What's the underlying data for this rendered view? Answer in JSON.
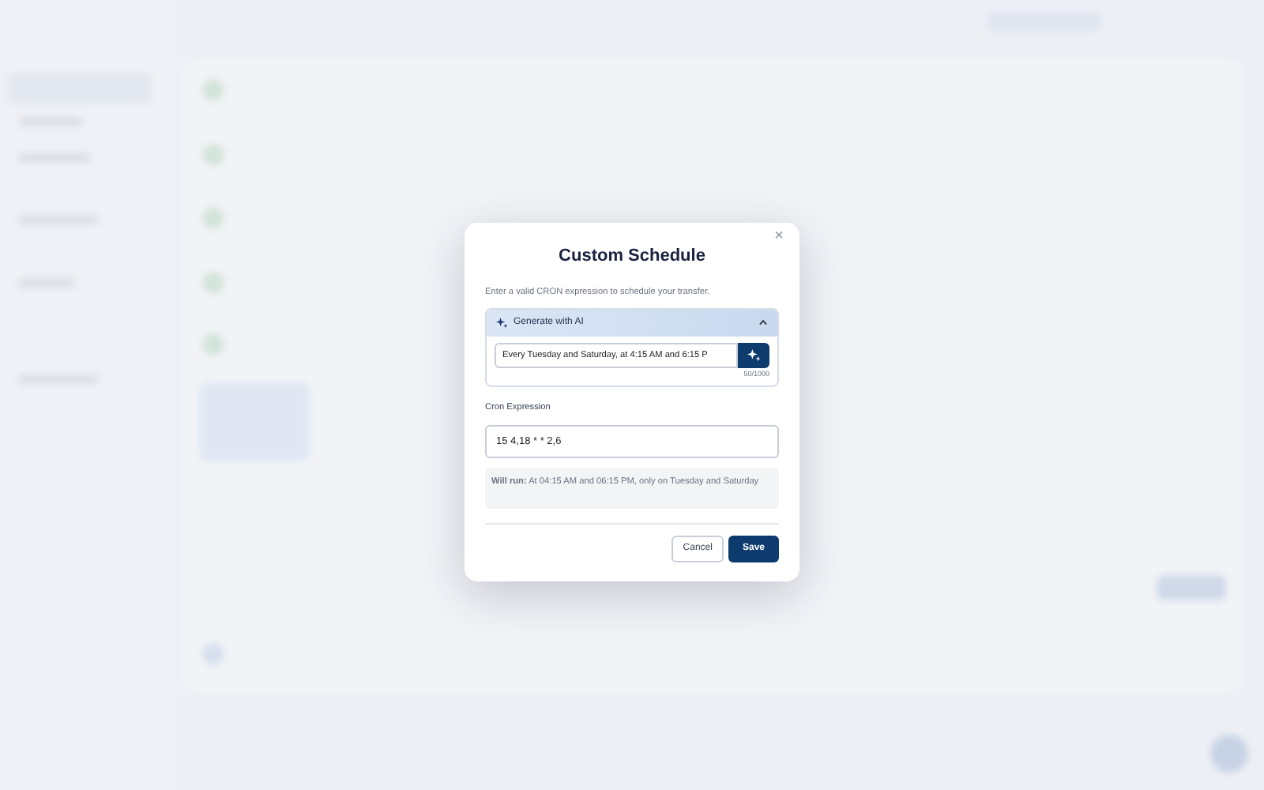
{
  "dialog": {
    "title": "Custom Schedule",
    "close": "×",
    "description": "Enter a valid CRON expression to schedule your transfer.",
    "ai_panel": {
      "title": "Generate with AI",
      "expanded": true,
      "prompt": "Every Tuesday and Saturday, at 4:15 AM and 6:15 P",
      "counter": "50/1000"
    },
    "cron_label": "Cron Expression",
    "cron_value": "15 4,18 * * 2,6",
    "summary": "**Will run:** At 04:15 AM and 06:15 PM, only on Tuesday and Saturday",
    "buttons": [
      {
        "label": "Cancel",
        "kind": "secondary"
      },
      {
        "label": "Save",
        "kind": "primary"
      }
    ]
  }
}
